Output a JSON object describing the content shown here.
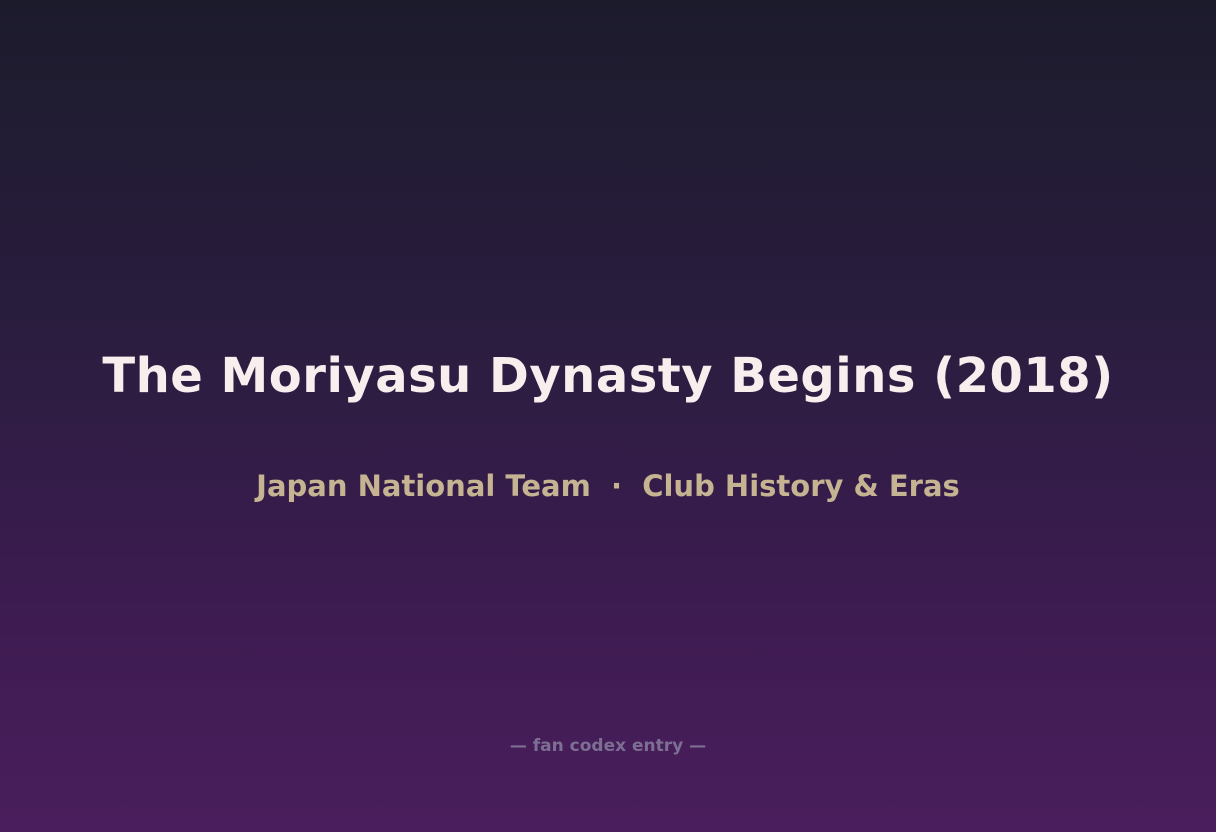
{
  "title": "The Moriyasu Dynasty Begins (2018)",
  "subtitle": "Japan National Team  ·  Club History & Eras",
  "footer": "— fan codex entry —",
  "colors": {
    "title": "#f8eeee",
    "subtitle": "#c5b392",
    "footer": "#7d6e93",
    "background_top": "#1c1b2c",
    "background_bottom": "#4a1e5c"
  }
}
